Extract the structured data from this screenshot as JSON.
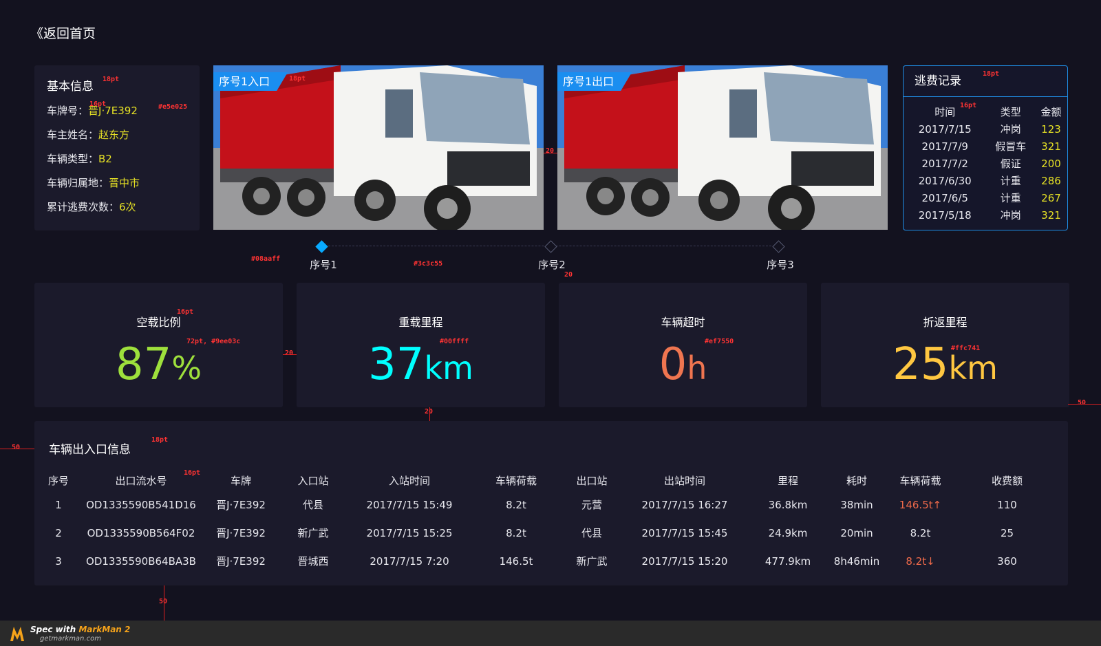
{
  "nav": {
    "back_label": "《返回首页"
  },
  "basic_info": {
    "title": "基本信息",
    "rows": [
      {
        "label": "车牌号：",
        "value": "晋J·7E392"
      },
      {
        "label": "车主姓名：",
        "value": "赵东方"
      },
      {
        "label": "车辆类型：",
        "value": "B2"
      },
      {
        "label": "车辆归属地：",
        "value": "晋中市"
      },
      {
        "label": "累计逃费次数：",
        "value": "6次"
      }
    ]
  },
  "photos": [
    {
      "tag": "序号1入口"
    },
    {
      "tag": "序号1出口"
    }
  ],
  "escape_records": {
    "title": "逃费记录",
    "headers": [
      "时间",
      "类型",
      "金额"
    ],
    "rows": [
      [
        "2017/7/15",
        "冲岗",
        "123"
      ],
      [
        "2017/7/9",
        "假冒车",
        "321"
      ],
      [
        "2017/7/2",
        "假证",
        "200"
      ],
      [
        "2017/6/30",
        "计重",
        "286"
      ],
      [
        "2017/6/5",
        "计重",
        "267"
      ],
      [
        "2017/5/18",
        "冲岗",
        "321"
      ]
    ]
  },
  "timeline": {
    "nodes": [
      "序号1",
      "序号2",
      "序号3"
    ],
    "active_color": "#08aaff",
    "line_color": "#3c3c55"
  },
  "stats": [
    {
      "label": "空载比例",
      "value": "87",
      "unit": "%",
      "color": "#9ee03c"
    },
    {
      "label": "重载里程",
      "value": "37",
      "unit": "km",
      "color": "#00ffff"
    },
    {
      "label": "车辆超时",
      "value": "0",
      "unit": "h",
      "color": "#ef7550"
    },
    {
      "label": "折返里程",
      "value": "25",
      "unit": "km",
      "color": "#ffc741"
    }
  ],
  "trips": {
    "title": "车辆出入口信息",
    "headers": [
      "序号",
      "出口流水号",
      "车牌",
      "入口站",
      "入站时间",
      "车辆荷载",
      "出口站",
      "出站时间",
      "里程",
      "耗时",
      "车辆荷载",
      "收费额"
    ],
    "rows": [
      [
        "1",
        "OD1335590B541D16",
        "晋J·7E392",
        "代县",
        "2017/7/15 15:49",
        "8.2t",
        "元营",
        "2017/7/15 16:27",
        "36.8km",
        "38min",
        "146.5t↑",
        "110"
      ],
      [
        "2",
        "OD1335590B564F02",
        "晋J·7E392",
        "新广武",
        "2017/7/15 15:25",
        "8.2t",
        "代县",
        "2017/7/15 15:45",
        "24.9km",
        "20min",
        "8.2t",
        "25"
      ],
      [
        "3",
        "OD1335590B64BA3B",
        "晋J·7E392",
        "晋城西",
        "2017/7/15 7:20",
        "146.5t",
        "新广武",
        "2017/7/15 15:20",
        "477.9km",
        "8h46min",
        "8.2t↓",
        "360"
      ]
    ]
  },
  "annotations": {
    "a1": "18pt",
    "a2": "18pt",
    "a3": "16pt",
    "a4": "#e5e025",
    "a5": "18pt",
    "a6": "16pt",
    "a7": "20",
    "a8": "#08aaff",
    "a9": "#3c3c55",
    "a10": "20",
    "a11": "16pt",
    "a12": "72pt, #9ee03c",
    "a13": "#00ffff",
    "a14": "#ef7550",
    "a15": "#ffc741",
    "a16": "20",
    "a17": "20",
    "a18": "50",
    "a19": "50",
    "a20": "18pt",
    "a21": "16pt",
    "a22": "50"
  },
  "footer": {
    "spec_prefix": "Spec with ",
    "spec_brand": "MarkMan 2",
    "site": "getmarkman.com"
  }
}
